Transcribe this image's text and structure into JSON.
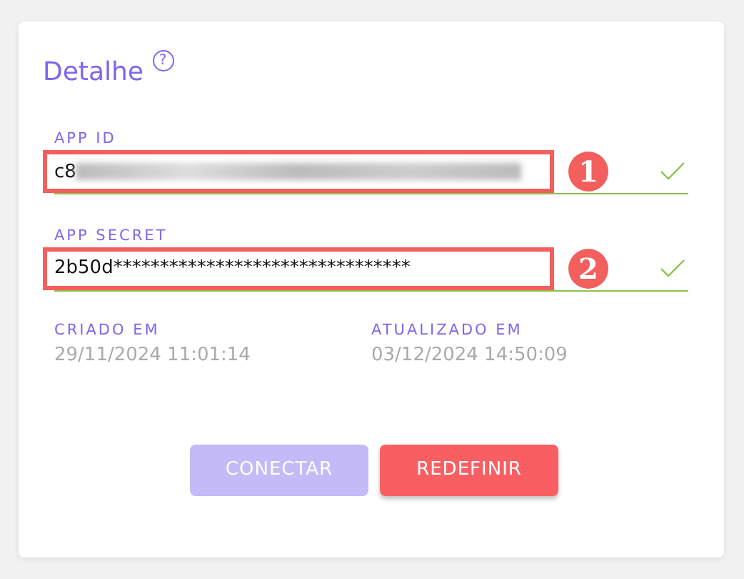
{
  "card": {
    "title": "Detalhe",
    "help": "?",
    "fields": [
      {
        "label": "APP ID",
        "value": "c8",
        "redacted": true,
        "valid": true,
        "highlighted": true,
        "marker": "1"
      },
      {
        "label": "APP SECRET",
        "value": "2b50d********************************",
        "redacted": false,
        "valid": true,
        "highlighted": true,
        "marker": "2"
      }
    ],
    "dates": [
      {
        "label": "CRIADO EM",
        "value": "29/11/2024 11:01:14"
      },
      {
        "label": "ATUALIZADO EM",
        "value": "03/12/2024 14:50:09"
      }
    ],
    "buttons": [
      {
        "label": "CONECTAR",
        "kind": "primary",
        "disabled": true
      },
      {
        "label": "REDEFINIR",
        "kind": "danger",
        "disabled": false
      }
    ]
  }
}
